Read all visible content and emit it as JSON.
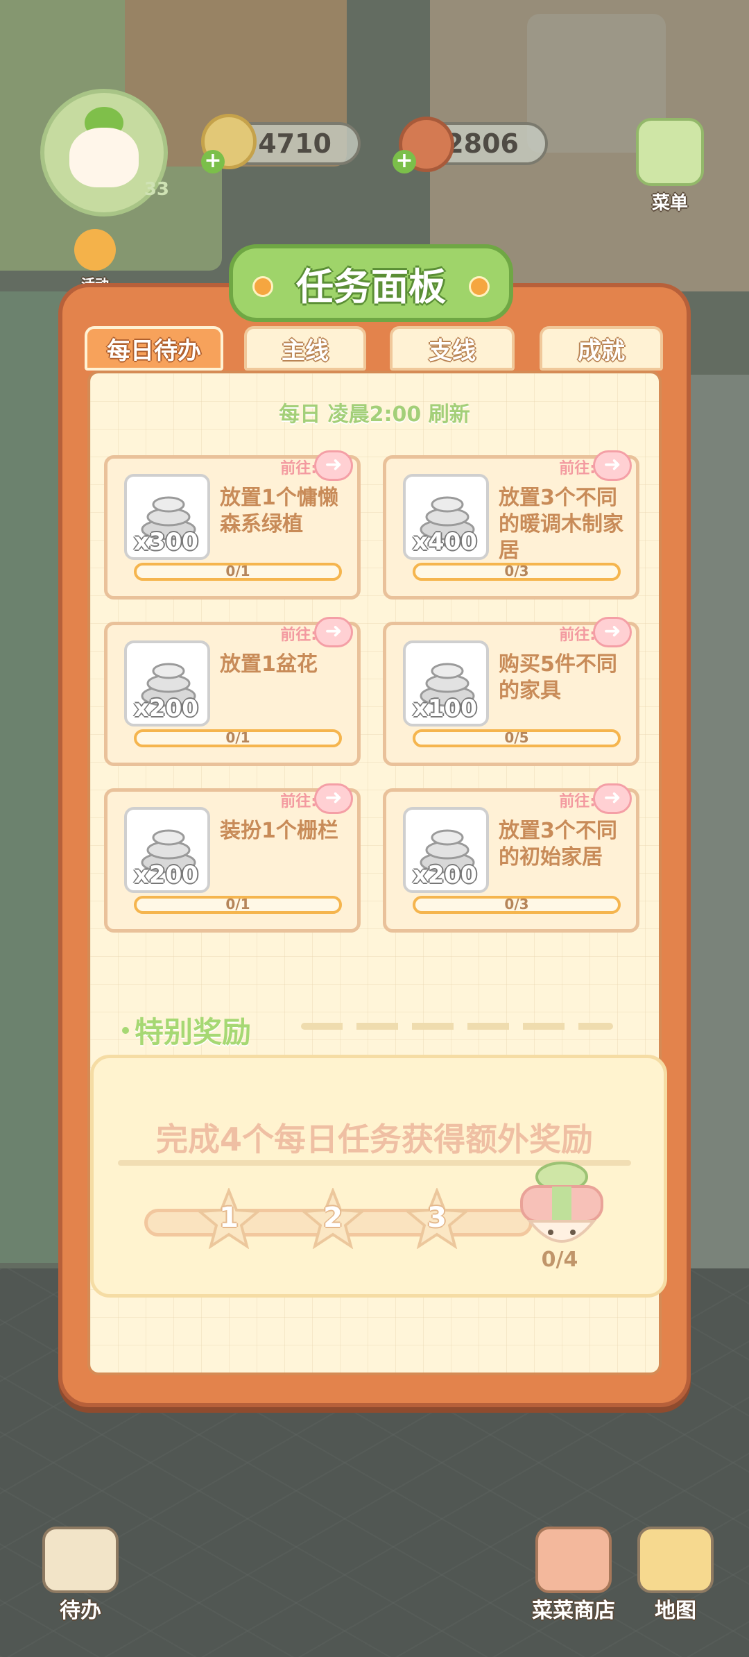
{
  "hud": {
    "level": "33",
    "coins": "4710",
    "gems": "2806",
    "side_top": "菜单",
    "side_event": "活动"
  },
  "panel": {
    "title": "任务面板",
    "tabs": [
      {
        "label": "每日待办",
        "active": true
      },
      {
        "label": "主线",
        "active": false
      },
      {
        "label": "支线",
        "active": false
      },
      {
        "label": "成就",
        "active": false
      }
    ],
    "refresh_note": "每日 凌晨2:00 刷新"
  },
  "tasks": [
    {
      "qty": "x300",
      "desc": "放置1个慵懒森系绿植",
      "goto": "前往:",
      "progress": "0/1",
      "ratio": 0
    },
    {
      "qty": "x400",
      "desc": "放置3个不同的暖调木制家居",
      "goto": "前往:",
      "progress": "0/3",
      "ratio": 0
    },
    {
      "qty": "x200",
      "desc": "放置1盆花",
      "goto": "前往:",
      "progress": "0/1",
      "ratio": 0
    },
    {
      "qty": "x100",
      "desc": "购买5件不同的家具",
      "goto": "前往:",
      "progress": "0/5",
      "ratio": 0
    },
    {
      "qty": "x200",
      "desc": "装扮1个栅栏",
      "goto": "前往:",
      "progress": "0/1",
      "ratio": 0
    },
    {
      "qty": "x200",
      "desc": "放置3个不同的初始家居",
      "goto": "前往:",
      "progress": "0/3",
      "ratio": 0
    }
  ],
  "special": {
    "heading": "特别奖励",
    "description": "完成4个每日任务获得额外奖励",
    "milestones": [
      "1",
      "2",
      "3"
    ],
    "gift_progress": "0/4",
    "ratio": 0
  },
  "bottom_nav": {
    "todo": "待办",
    "shop": "菜菜商店",
    "map": "地图"
  },
  "colors": {
    "panel_orange": "#e3834c",
    "title_green": "#9fd46a",
    "progress_yellow": "#f5b54e",
    "goto_pink": "#f39aa0"
  }
}
